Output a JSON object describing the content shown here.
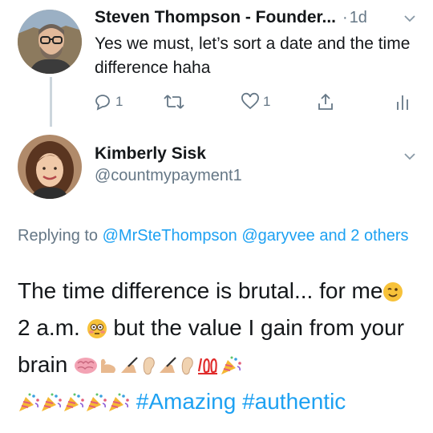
{
  "tweet1": {
    "author": "Steven Thompson - Founder...",
    "separator": "·",
    "time": "1d",
    "text": "Yes we must, let’s sort a date and the time difference haha",
    "actions": {
      "reply_count": "1",
      "retweet_count": "",
      "like_count": "1"
    }
  },
  "tweet2": {
    "author": "Kimberly Sisk",
    "handle": "@countmypayment1",
    "replying": {
      "prefix": "Replying to",
      "mention1": "@MrSteThompson",
      "mention2": "@garyvee",
      "and_others": "and 2 others"
    },
    "text": {
      "part1": "The time difference is brutal... for me",
      "part2": "2 a.m.",
      "part3": "but the value I gain from your brain",
      "hashtag1": "#Amazing",
      "hashtag2": "#authentic"
    }
  },
  "icons": [
    "chevron-down-icon",
    "reply-icon",
    "retweet-icon",
    "like-icon",
    "share-icon",
    "stats-icon",
    "winking-face-emoji",
    "flushed-face-emoji",
    "brain-emoji",
    "flexed-biceps-emoji",
    "writing-hand-emoji",
    "ear-emoji",
    "hundred-points-emoji",
    "party-popper-emoji"
  ],
  "colors": {
    "link": "#1da1f2",
    "secondary_text": "#657786",
    "primary_text": "#14171a",
    "thread_line": "#ccd6dd"
  }
}
